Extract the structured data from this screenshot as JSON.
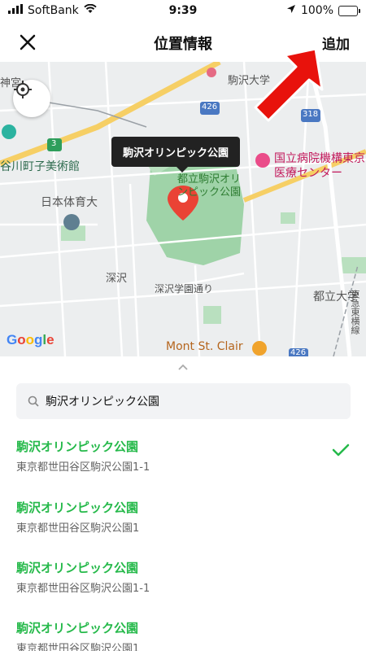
{
  "status_bar": {
    "carrier": "SoftBank",
    "time": "9:39",
    "battery": "100%",
    "battery_level": 1.0
  },
  "nav": {
    "title": "位置情報",
    "add_label": "追加"
  },
  "map": {
    "tooltip": "駒沢オリンピック公園",
    "logo": "Google",
    "labels": {
      "komazawa_univ": "駒沢大学",
      "park": "都立駒沢オリンピック公園",
      "hospital": "国立病院機構東京医療センター",
      "gallery": "谷川町子美術館",
      "sports_univ": "日本体育大",
      "fukasawa": "深沢",
      "fukasawa_street": "深沢学園通り",
      "toritsu_univ": "都立大学",
      "mont_st_clair": "Mont St. Clair",
      "shrine": "神宮",
      "tokyu_line": "東急東横線",
      "route_426_top": "426",
      "route_318": "318",
      "route_3": "3",
      "route_426_bottom": "426"
    }
  },
  "search": {
    "value": "駒沢オリンピック公園"
  },
  "results": [
    {
      "name": "駒沢オリンピック公園",
      "address": "東京都世田谷区駒沢公園1-1",
      "selected": true
    },
    {
      "name": "駒沢オリンピック公園",
      "address": "東京都世田谷区駒沢公園1",
      "selected": false
    },
    {
      "name": "駒沢オリンピック公園",
      "address": "東京都世田谷区駒沢公園1-1",
      "selected": false
    },
    {
      "name": "駒沢オリンピック公園",
      "address": "東京都世田谷区駒沢公園1",
      "selected": false
    }
  ],
  "colors": {
    "accent_green": "#25b94a",
    "pin_red": "#ea4335",
    "annotation_red": "#e8120c"
  }
}
